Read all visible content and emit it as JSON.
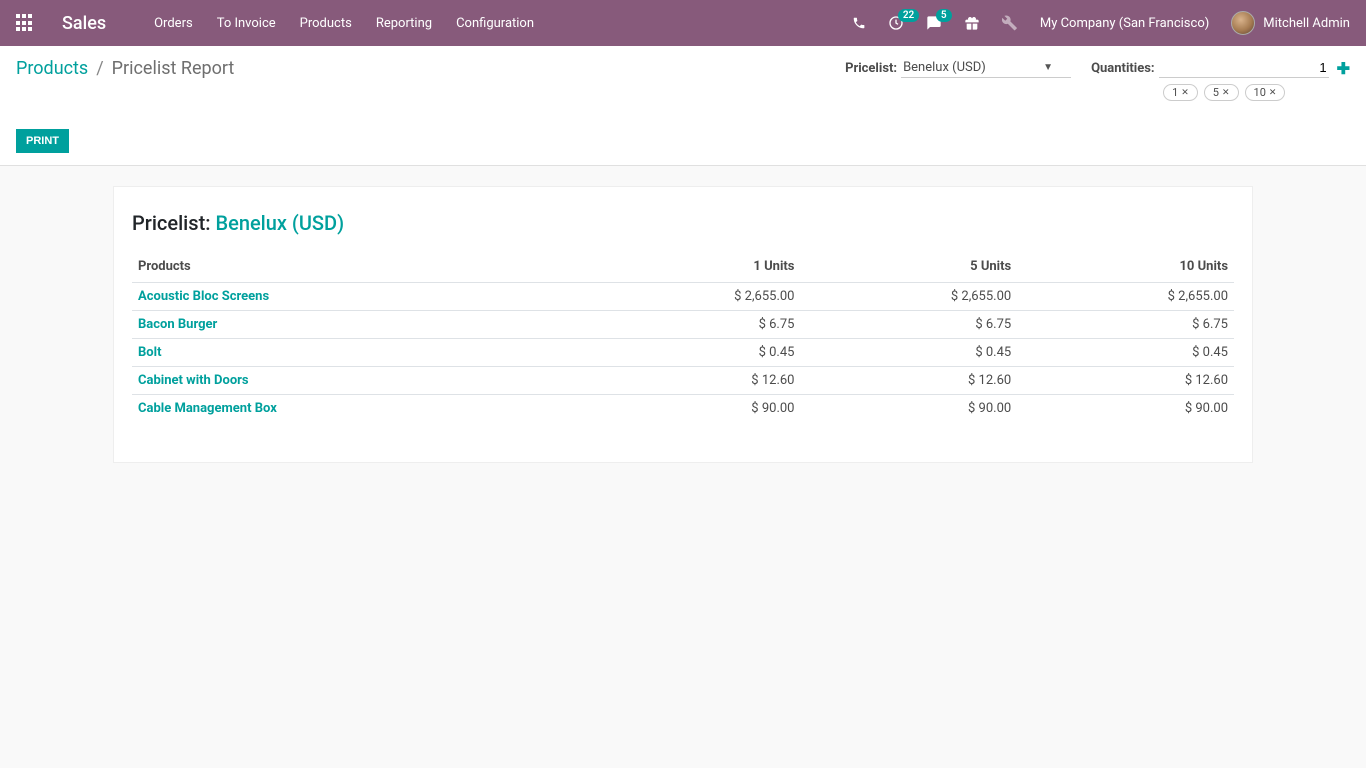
{
  "header": {
    "brand": "Sales",
    "nav": [
      "Orders",
      "To Invoice",
      "Products",
      "Reporting",
      "Configuration"
    ],
    "activities_badge": "22",
    "messages_badge": "5",
    "company": "My Company (San Francisco)",
    "user": "Mitchell Admin"
  },
  "breadcrumb": {
    "parent": "Products",
    "current": "Pricelist Report"
  },
  "controls": {
    "pricelist_label": "Pricelist:",
    "pricelist_value": "Benelux (USD)",
    "quantities_label": "Quantities:",
    "quantities_value": "1",
    "qty_badges": [
      "1",
      "5",
      "10"
    ],
    "print_label": "Print"
  },
  "report": {
    "title_prefix": "Pricelist: ",
    "pricelist_name": "Benelux (USD)",
    "columns": {
      "products": "Products",
      "q1": "1 Units",
      "q5": "5 Units",
      "q10": "10 Units"
    },
    "rows": [
      {
        "product": "Acoustic Bloc Screens",
        "q1": "$ 2,655.00",
        "q5": "$ 2,655.00",
        "q10": "$ 2,655.00"
      },
      {
        "product": "Bacon Burger",
        "q1": "$ 6.75",
        "q5": "$ 6.75",
        "q10": "$ 6.75"
      },
      {
        "product": "Bolt",
        "q1": "$ 0.45",
        "q5": "$ 0.45",
        "q10": "$ 0.45"
      },
      {
        "product": "Cabinet with Doors",
        "q1": "$ 12.60",
        "q5": "$ 12.60",
        "q10": "$ 12.60"
      },
      {
        "product": "Cable Management Box",
        "q1": "$ 90.00",
        "q5": "$ 90.00",
        "q10": "$ 90.00"
      }
    ]
  }
}
